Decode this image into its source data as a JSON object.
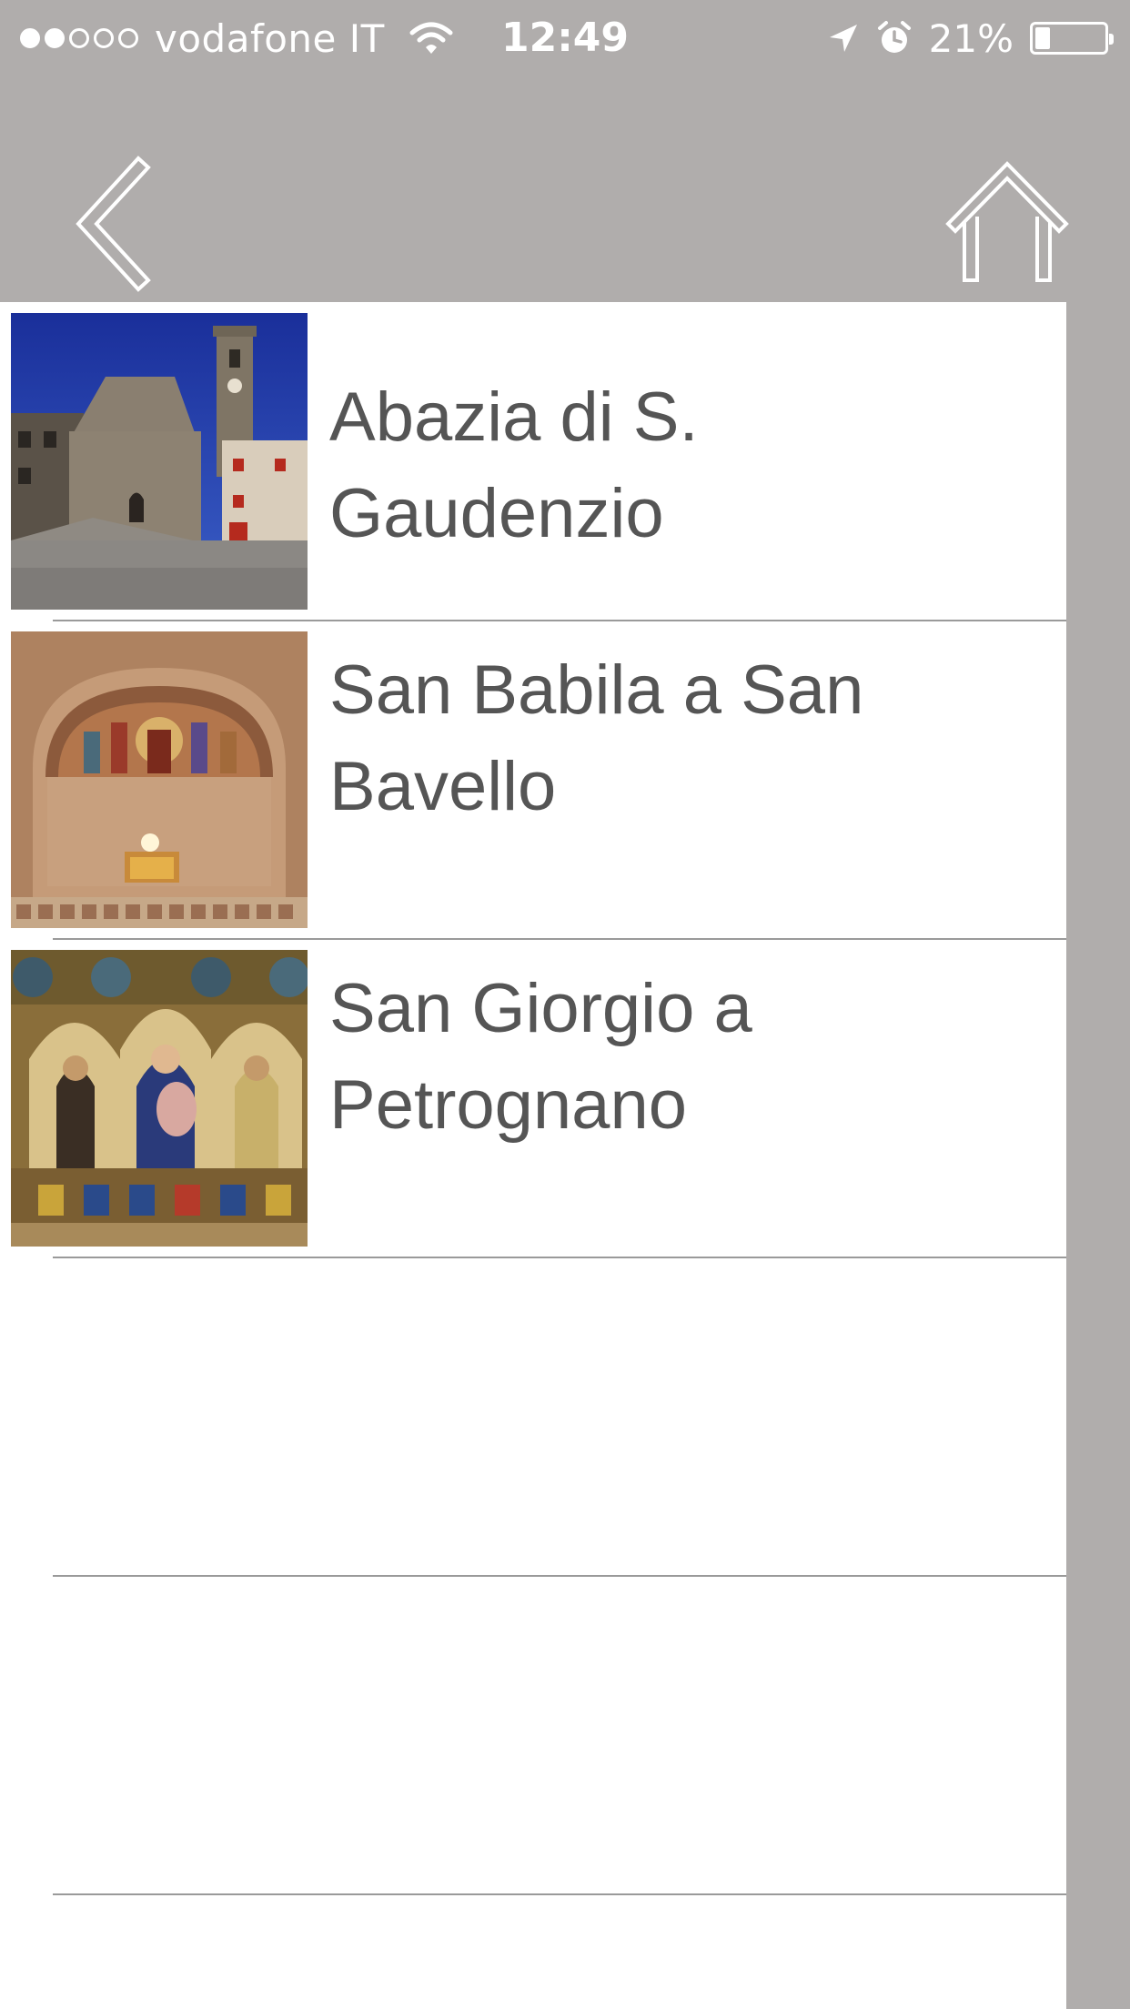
{
  "status_bar": {
    "carrier": "vodafone IT",
    "time": "12:49",
    "battery_percent": "21%",
    "battery_level": 0.21,
    "signal_strength_dots_filled": 2,
    "signal_strength_dots_total": 5,
    "icons": [
      "signal-dots-icon",
      "wifi-icon",
      "location-arrow-icon",
      "alarm-clock-icon",
      "battery-icon"
    ],
    "text_color": "#ffffff"
  },
  "nav_bar": {
    "background_color": "#b0adac",
    "back_icon": "chevron-left-icon",
    "home_icon": "home-icon"
  },
  "list": {
    "background_color": "#ffffff",
    "text_color": "#555555",
    "separator_color": "#9a9a9a",
    "items": [
      {
        "title": "Abazia di S. Gaudenzio",
        "thumbnail": "abbey-church-photo"
      },
      {
        "title": "San Babila a San Bavello",
        "thumbnail": "fresco-apse-photo"
      },
      {
        "title": "San Giorgio a Petrognano",
        "thumbnail": "altarpiece-painting-photo"
      }
    ]
  }
}
